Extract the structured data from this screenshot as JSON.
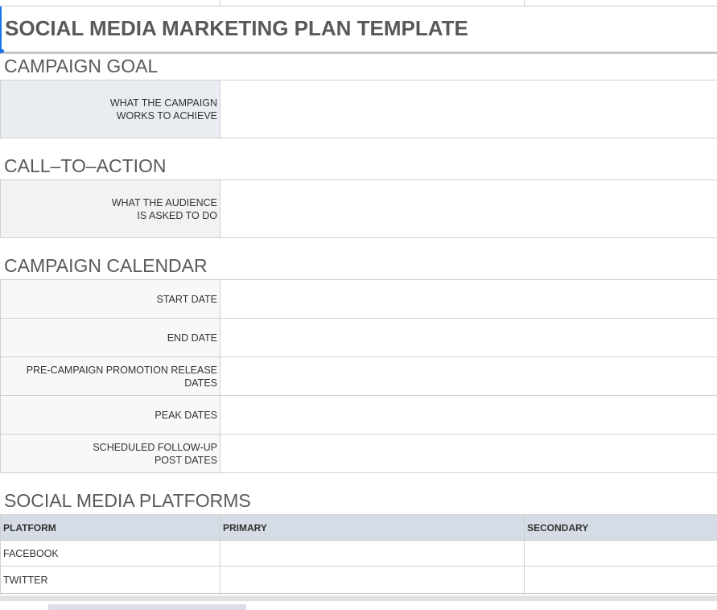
{
  "title": "SOCIAL MEDIA MARKETING PLAN TEMPLATE",
  "campaign_goal": {
    "heading": "CAMPAIGN GOAL",
    "label_lines": [
      "WHAT THE CAMPAIGN",
      "WORKS TO ACHIEVE"
    ],
    "value": ""
  },
  "call_to_action": {
    "heading": "CALL–TO–ACTION",
    "label_lines": [
      "WHAT THE AUDIENCE",
      "IS ASKED TO DO"
    ],
    "value": ""
  },
  "campaign_calendar": {
    "heading": "CAMPAIGN CALENDAR",
    "rows": [
      {
        "label_lines": [
          "START DATE"
        ],
        "value": ""
      },
      {
        "label_lines": [
          "END DATE"
        ],
        "value": ""
      },
      {
        "label_lines": [
          "PRE-CAMPAIGN PROMOTION RELEASE",
          "DATES"
        ],
        "value": ""
      },
      {
        "label_lines": [
          "PEAK DATES"
        ],
        "value": ""
      },
      {
        "label_lines": [
          "SCHEDULED FOLLOW-UP",
          "POST DATES"
        ],
        "value": ""
      }
    ]
  },
  "social_media_platforms": {
    "heading": "SOCIAL MEDIA PLATFORMS",
    "columns": [
      "PLATFORM",
      "PRIMARY",
      "SECONDARY"
    ],
    "rows": [
      [
        "FACEBOOK",
        "",
        ""
      ],
      [
        "TWITTER",
        "",
        ""
      ]
    ]
  },
  "colors": {
    "label_blue": "#e9edf2",
    "label_grey": "#f2f2f2",
    "header_fill": "#d5dce5",
    "heading_text": "#595959",
    "selection_blue": "#1a73e8"
  }
}
